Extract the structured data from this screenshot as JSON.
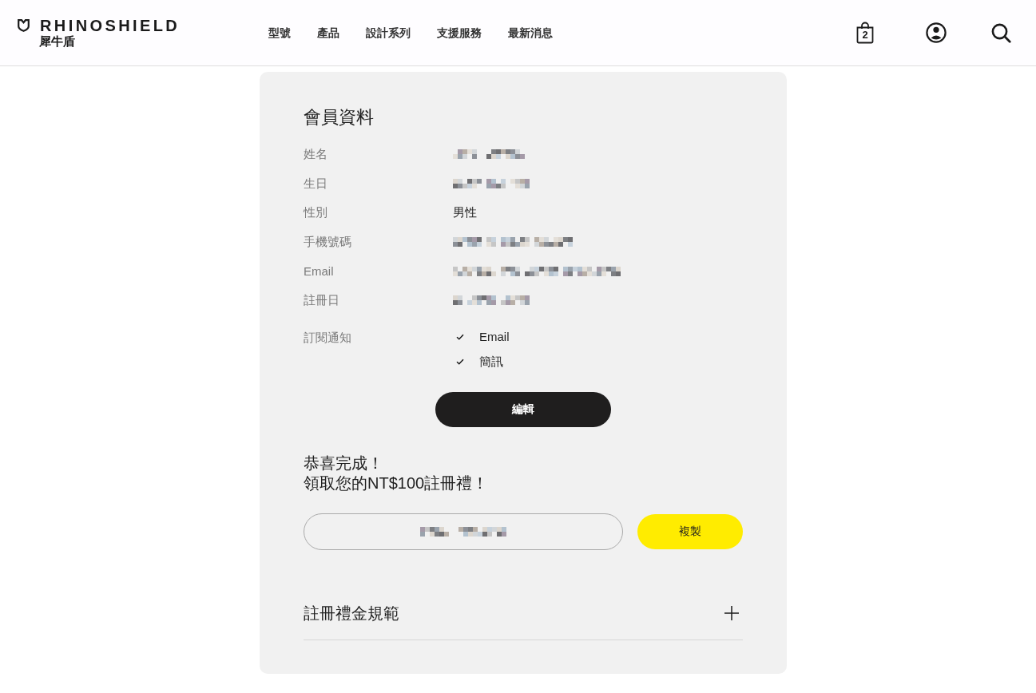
{
  "header": {
    "logo": {
      "wordmark": "RHINOSHIELD",
      "chinese_name": "犀牛盾"
    },
    "nav": [
      "型號",
      "產品",
      "設計系列",
      "支援服務",
      "最新消息"
    ],
    "cart_count": "2"
  },
  "member_profile": {
    "title": "會員資料",
    "fields": [
      {
        "label": "姓名",
        "kind": "redacted"
      },
      {
        "label": "生日",
        "kind": "redacted"
      },
      {
        "label": "性別",
        "kind": "text",
        "value": "男性"
      },
      {
        "label": "手機號碼",
        "kind": "redacted"
      },
      {
        "label": "Email",
        "kind": "redacted"
      },
      {
        "label": "註冊日",
        "kind": "redacted"
      }
    ],
    "subscriptions": {
      "label": "訂閱通知",
      "options": [
        {
          "label": "Email",
          "checked": true
        },
        {
          "label": "簡訊",
          "checked": true
        }
      ]
    },
    "edit_button": "編輯"
  },
  "reward": {
    "message_lines": [
      "恭喜完成！",
      "領取您的NT$100註冊禮！"
    ],
    "coupon_code": {
      "redacted": true
    },
    "copy_button": "複製"
  },
  "accordion": {
    "title": "註冊禮金規範",
    "expanded": false
  }
}
